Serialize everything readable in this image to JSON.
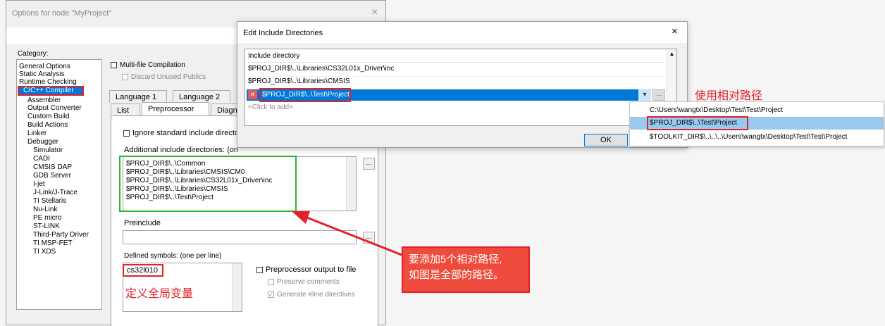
{
  "options_dialog": {
    "title": "Options for node \"MyProject\"",
    "close": "×",
    "category_label": "Category:",
    "categories": [
      "General Options",
      "Static Analysis",
      "Runtime Checking",
      "C/C++ Compiler",
      "Assembler",
      "Output Converter",
      "Custom Build",
      "Build Actions",
      "Linker",
      "Debugger",
      "Simulator",
      "CADI",
      "CMSIS DAP",
      "GDB Server",
      "I-jet",
      "J-Link/J-Trace",
      "TI Stellaris",
      "Nu-Link",
      "PE micro",
      "ST-LINK",
      "Third-Party Driver",
      "TI MSP-FET",
      "TI XDS"
    ],
    "multi_file_compilation": "Multi-file Compilation",
    "discard_unused_publics": "Discard Unused Publics",
    "tabs_row1": [
      "Language 1",
      "Language 2"
    ],
    "tabs_row2": [
      "List",
      "Preprocessor",
      "Diagn"
    ],
    "ignore_std_include": "Ignore standard include directo",
    "additional_include_label": "Additional include directories: (on",
    "include_dirs": [
      "$PROJ_DIR$\\..\\Common",
      "$PROJ_DIR$\\..\\Libraries\\CMSIS\\CM0",
      "$PROJ_DIR$\\..\\Libraries\\CS32L01x_Driver\\inc",
      "$PROJ_DIR$\\..\\Libraries\\CMSIS",
      "$PROJ_DIR$\\..\\Test\\Project"
    ],
    "browse": "...",
    "preinclude_label": "Preinclude",
    "defined_symbols_label": "Defined symbols: (one per line)",
    "defined_symbol": "cs32l010",
    "preprocessor_output": "Preprocessor output to file",
    "preserve_comments": "Preserve comments",
    "generate_line_directives": "Generate #line directives"
  },
  "edit_dialog": {
    "title": "Edit Include Directories",
    "close": "×",
    "column_header": "Include directory",
    "rows": [
      "$PROJ_DIR$\\..\\Libraries\\CS32L01x_Driver\\inc",
      "$PROJ_DIR$\\..\\Libraries\\CMSIS"
    ],
    "selected_row": "$PROJ_DIR$\\..\\Test\\Project",
    "delete_icon_glyph": "✕",
    "dropdown_arrow": "▾",
    "ellipsis": "...",
    "click_to_add": "<Click to add>",
    "ok_label": "OK"
  },
  "dropdown": {
    "options": [
      "C:\\Users\\wangtx\\Desktop\\Test\\Test\\Project",
      "$PROJ_DIR$\\..\\Test\\Project",
      "$TOOLKIT_DIR$\\..\\..\\..\\Users\\wangtx\\Desktop\\Test\\Test\\Project"
    ],
    "selected_index": 1
  },
  "annotations": {
    "relative_path": "使用相对路径",
    "global_var": "定义全局变量",
    "note_line1": "要添加5个相对路径,",
    "note_line2": "如图是全部的路径。"
  },
  "colors": {
    "accent_red": "#e4202a",
    "highlight_green": "#2eb52e",
    "selection_blue": "#0078d7",
    "dropdown_selected": "#99c9ef",
    "note_fill": "#ef4b3c"
  }
}
